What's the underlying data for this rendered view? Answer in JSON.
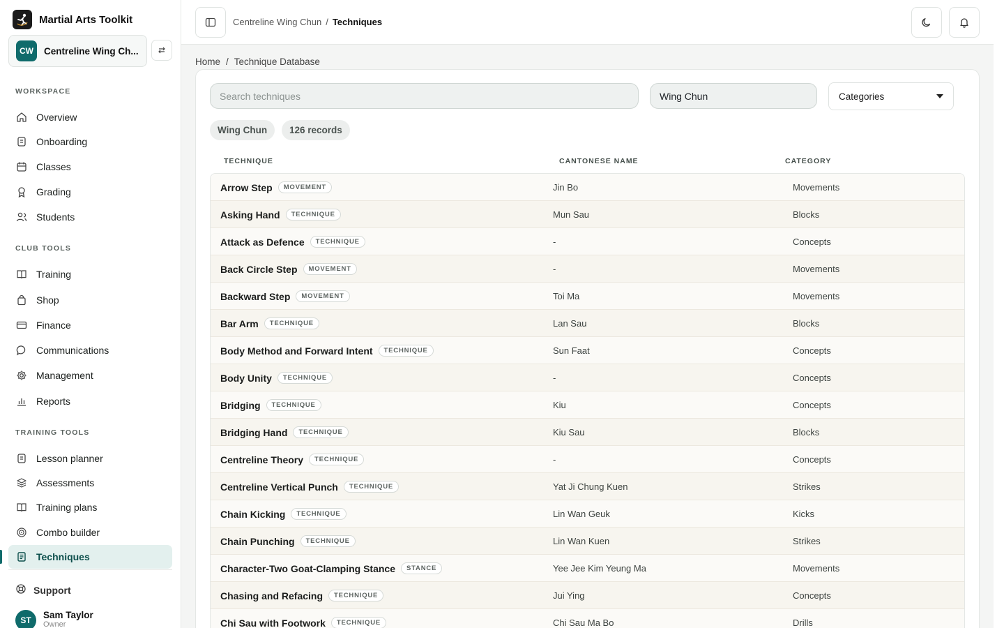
{
  "app": {
    "title": "Martial Arts Toolkit"
  },
  "club": {
    "initials": "CW",
    "name": "Centreline Wing Ch..."
  },
  "sidebar": {
    "sections": {
      "workspace": "WORKSPACE",
      "club_tools": "CLUB TOOLS",
      "training_tools": "TRAINING TOOLS"
    },
    "workspace_items": [
      {
        "label": "Overview",
        "icon": "home-icon"
      },
      {
        "label": "Onboarding",
        "icon": "clipboard-icon"
      },
      {
        "label": "Classes",
        "icon": "calendar-icon"
      },
      {
        "label": "Grading",
        "icon": "award-icon"
      },
      {
        "label": "Students",
        "icon": "users-icon"
      }
    ],
    "club_items": [
      {
        "label": "Training",
        "icon": "book-icon"
      },
      {
        "label": "Shop",
        "icon": "shopping-bag-icon"
      },
      {
        "label": "Finance",
        "icon": "credit-card-icon"
      },
      {
        "label": "Communications",
        "icon": "chat-icon"
      },
      {
        "label": "Management",
        "icon": "gear-icon"
      },
      {
        "label": "Reports",
        "icon": "bar-chart-icon"
      }
    ],
    "training_items": [
      {
        "label": "Lesson planner",
        "icon": "clipboard-icon"
      },
      {
        "label": "Assessments",
        "icon": "layers-icon"
      },
      {
        "label": "Training plans",
        "icon": "book-icon"
      },
      {
        "label": "Combo builder",
        "icon": "target-icon"
      },
      {
        "label": "Techniques",
        "icon": "document-icon"
      }
    ],
    "support_label": "Support",
    "user": {
      "initials": "ST",
      "name": "Sam Taylor",
      "role": "Owner"
    }
  },
  "topbar": {
    "crumb_parent": "Centreline Wing Chun",
    "crumb_sep": "/",
    "crumb_current": "Techniques"
  },
  "breadcrumb": {
    "home": "Home",
    "sep": "/",
    "current": "Technique Database"
  },
  "filters": {
    "search_placeholder": "Search techniques",
    "style_value": "Wing Chun",
    "category_label": "Categories"
  },
  "chips": {
    "style": "Wing Chun",
    "count": "126 records"
  },
  "table": {
    "headers": {
      "technique": "TECHNIQUE",
      "cantonese": "CANTONESE NAME",
      "category": "CATEGORY"
    },
    "rows": [
      {
        "name": "Arrow Step",
        "type": "MOVEMENT",
        "cantonese": "Jin Bo",
        "category": "Movements"
      },
      {
        "name": "Asking Hand",
        "type": "TECHNIQUE",
        "cantonese": "Mun Sau",
        "category": "Blocks"
      },
      {
        "name": "Attack as Defence",
        "type": "TECHNIQUE",
        "cantonese": "-",
        "category": "Concepts"
      },
      {
        "name": "Back Circle Step",
        "type": "MOVEMENT",
        "cantonese": "-",
        "category": "Movements"
      },
      {
        "name": "Backward Step",
        "type": "MOVEMENT",
        "cantonese": "Toi Ma",
        "category": "Movements"
      },
      {
        "name": "Bar Arm",
        "type": "TECHNIQUE",
        "cantonese": "Lan Sau",
        "category": "Blocks"
      },
      {
        "name": "Body Method and Forward Intent",
        "type": "TECHNIQUE",
        "cantonese": "Sun Faat",
        "category": "Concepts"
      },
      {
        "name": "Body Unity",
        "type": "TECHNIQUE",
        "cantonese": "-",
        "category": "Concepts"
      },
      {
        "name": "Bridging",
        "type": "TECHNIQUE",
        "cantonese": "Kiu",
        "category": "Concepts"
      },
      {
        "name": "Bridging Hand",
        "type": "TECHNIQUE",
        "cantonese": "Kiu Sau",
        "category": "Blocks"
      },
      {
        "name": "Centreline Theory",
        "type": "TECHNIQUE",
        "cantonese": "-",
        "category": "Concepts"
      },
      {
        "name": "Centreline Vertical Punch",
        "type": "TECHNIQUE",
        "cantonese": "Yat Ji Chung Kuen",
        "category": "Strikes"
      },
      {
        "name": "Chain Kicking",
        "type": "TECHNIQUE",
        "cantonese": "Lin Wan Geuk",
        "category": "Kicks"
      },
      {
        "name": "Chain Punching",
        "type": "TECHNIQUE",
        "cantonese": "Lin Wan Kuen",
        "category": "Strikes"
      },
      {
        "name": "Character-Two Goat-Clamping Stance",
        "type": "STANCE",
        "cantonese": "Yee Jee Kim Yeung Ma",
        "category": "Movements"
      },
      {
        "name": "Chasing and Refacing",
        "type": "TECHNIQUE",
        "cantonese": "Jui Ying",
        "category": "Concepts"
      },
      {
        "name": "Chi Sau with Footwork",
        "type": "TECHNIQUE",
        "cantonese": "Chi Sau Ma Bo",
        "category": "Drills"
      }
    ]
  },
  "colors": {
    "accent": "#0f6b6b",
    "active_bg": "#e3f0ee"
  }
}
